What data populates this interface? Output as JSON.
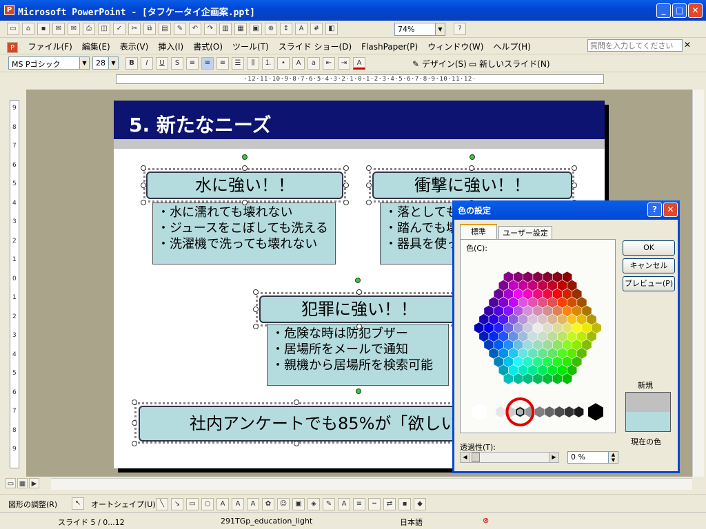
{
  "window": {
    "title": "Microsoft PowerPoint - [タフケータイ企画案.ppt]"
  },
  "toolbar": {
    "zoom": "74%"
  },
  "menu": [
    "ファイル(F)",
    "編集(E)",
    "表示(V)",
    "挿入(I)",
    "書式(O)",
    "ツール(T)",
    "スライド ショー(D)",
    "FlashPaper(P)",
    "ウィンドウ(W)",
    "ヘルプ(H)"
  ],
  "help_search": {
    "placeholder": "質問を入力してください"
  },
  "format": {
    "font": "MS Pゴシック",
    "size": "28",
    "design_label": "デザイン(S)",
    "new_slide_label": "新しいスライド(N)"
  },
  "ruler": {
    "h_labels": "·12·11·10·9·8·7·6·5·4·3·2·1·0·1·2·3·4·5·6·7·8·9·10·11·12·"
  },
  "slide": {
    "title": "5. 新たなニーズ",
    "box1": {
      "head": "水に強い！！",
      "items": [
        "・水に濡れても壊れない",
        "・ジュースをこぼしても洗える",
        "・洗濯機で洗っても壊れない"
      ]
    },
    "box2": {
      "head": "衝撃に強い！！",
      "items": [
        "・落としても",
        "・踏んでも壊",
        "・器具を使っ"
      ]
    },
    "box3": {
      "head": "犯罪に強い！！",
      "items": [
        "・危険な時は防犯ブザー",
        "・居場所をメールで通知",
        "・親機から居場所を検索可能"
      ]
    },
    "bottom": "社内アンケートでも85%が「欲しい"
  },
  "dialog": {
    "title": "色の設定",
    "tab_standard": "標準",
    "tab_custom": "ユーザー設定",
    "colors_label": "色(C):",
    "ok": "OK",
    "cancel": "キャンセル",
    "preview": "プレビュー(P)",
    "new_label": "新規",
    "current_label": "現在の色",
    "transparency_label": "透過性(T):",
    "transparency_value": "0 %",
    "new_color": "#c0c0c0",
    "current_color": "#b4dbdd"
  },
  "drawbar": {
    "adjust": "図形の調整(R)",
    "autoshape": "オートシェイプ(U)"
  },
  "status": {
    "slide": "スライド 5 / 0...12",
    "design": "291TGp_education_light",
    "lang": "日本語"
  }
}
